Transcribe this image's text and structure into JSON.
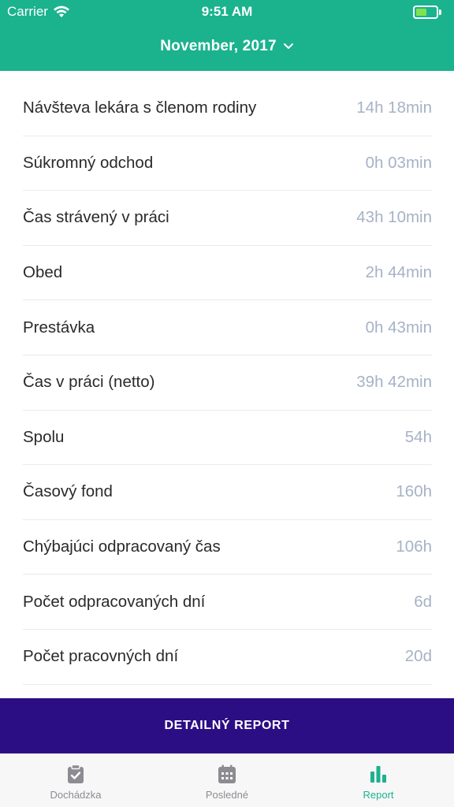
{
  "status_bar": {
    "carrier": "Carrier",
    "time": "9:51 AM",
    "battery_level": 0.55
  },
  "header": {
    "month": "November, 2017"
  },
  "rows": [
    {
      "label": "Návšteva lekára s členom rodiny",
      "value": "14h 18min"
    },
    {
      "label": "Súkromný odchod",
      "value": "0h 03min"
    },
    {
      "label": "Čas strávený v práci",
      "value": "43h 10min"
    },
    {
      "label": "Obed",
      "value": "2h 44min"
    },
    {
      "label": "Prestávka",
      "value": "0h 43min"
    },
    {
      "label": "Čas v práci (netto)",
      "value": "39h 42min"
    },
    {
      "label": "Spolu",
      "value": "54h"
    },
    {
      "label": "Časový fond",
      "value": "160h"
    },
    {
      "label": "Chýbajúci odpracovaný čas",
      "value": "106h"
    },
    {
      "label": "Počet odpracovaných dní",
      "value": "6d"
    },
    {
      "label": "Počet pracovných dní",
      "value": "20d"
    }
  ],
  "report_button": {
    "label": "DETAILNÝ REPORT"
  },
  "tabs": [
    {
      "label": "Dochádzka",
      "icon": "clipboard-check-icon",
      "active": false
    },
    {
      "label": "Posledné",
      "icon": "calendar-icon",
      "active": false
    },
    {
      "label": "Report",
      "icon": "bar-chart-icon",
      "active": true
    }
  ],
  "colors": {
    "primary": "#1bb28e",
    "button": "#2c0e84",
    "value_text": "#a6b2c6"
  }
}
